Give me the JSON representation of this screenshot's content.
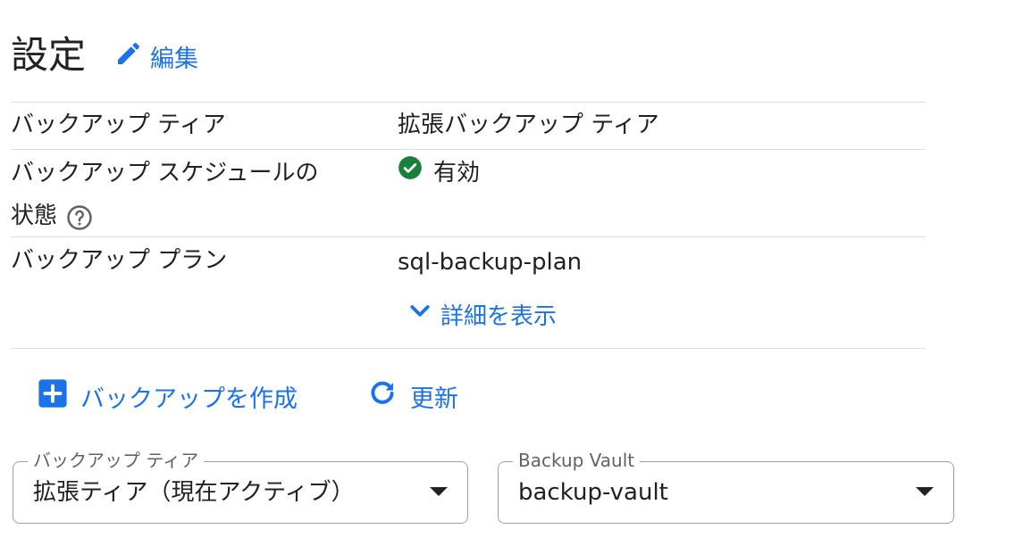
{
  "header": {
    "title": "設定",
    "edit_label": "編集"
  },
  "rows": [
    {
      "label": "バックアップ ティア",
      "value": "拡張バックアップ ティア"
    },
    {
      "label_line1": "バックアップ スケジュールの",
      "label_line2": "状態",
      "value": "有効"
    },
    {
      "label": "バックアップ プラン",
      "value": "sql-backup-plan"
    }
  ],
  "details_link": "詳細を表示",
  "actions": {
    "create_backup": "バックアップを作成",
    "refresh": "更新"
  },
  "selects": [
    {
      "legend": "バックアップ ティア",
      "value": "拡張ティア（現在アクティブ）"
    },
    {
      "legend": "Backup Vault",
      "value": "backup-vault"
    }
  ],
  "colors": {
    "link": "#1a73e8",
    "success": "#188038",
    "divider": "#dadce0"
  },
  "icons": {
    "edit": "pencil-icon",
    "help": "help-circle-icon",
    "status": "check-circle-icon",
    "expand": "chevron-down-icon",
    "create": "add-box-icon",
    "refresh": "refresh-icon",
    "dropdown": "dropdown-arrow-icon"
  }
}
